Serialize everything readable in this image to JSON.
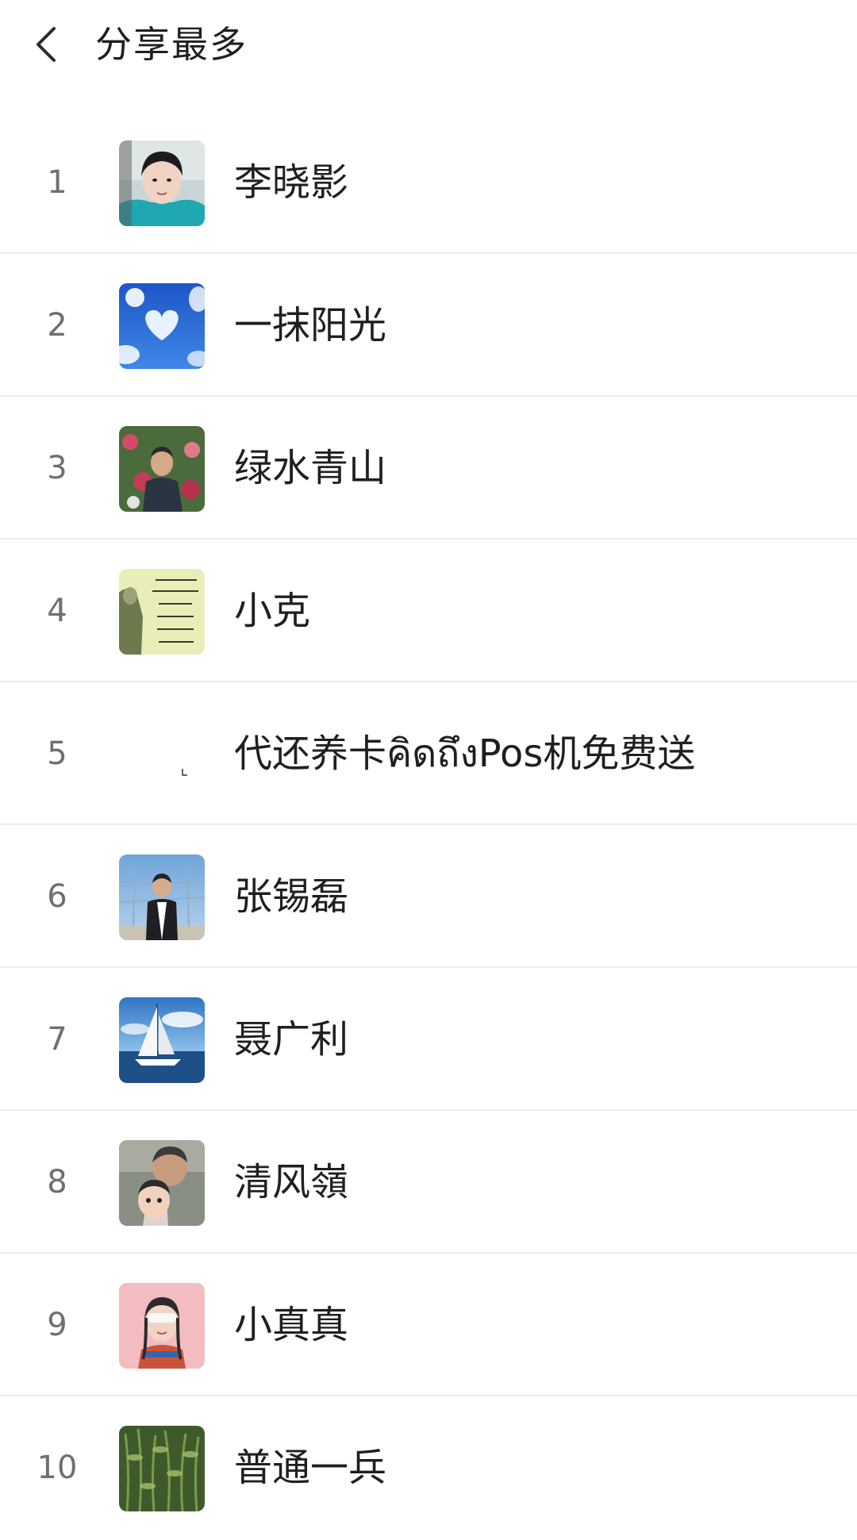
{
  "header": {
    "title": "分享最多",
    "back_icon": "chevron-left-icon"
  },
  "list": {
    "items": [
      {
        "rank": "1",
        "name": "李晓影",
        "avatar": "person-portrait-avatar"
      },
      {
        "rank": "2",
        "name": "一抹阳光",
        "avatar": "heart-cloud-sky-avatar"
      },
      {
        "rank": "3",
        "name": "绿水青山",
        "avatar": "man-flowers-avatar"
      },
      {
        "rank": "4",
        "name": "小克",
        "avatar": "calligraphy-text-avatar"
      },
      {
        "rank": "5",
        "name": "代还养卡คิดถึงPos机免费送",
        "avatar": "blank-avatar"
      },
      {
        "rank": "6",
        "name": "张锡磊",
        "avatar": "man-outdoors-avatar"
      },
      {
        "rank": "7",
        "name": "聂广利",
        "avatar": "sailboat-avatar"
      },
      {
        "rank": "8",
        "name": "清风嶺",
        "avatar": "man-with-child-avatar"
      },
      {
        "rank": "9",
        "name": "小真真",
        "avatar": "girl-eye-mask-avatar"
      },
      {
        "rank": "10",
        "name": "普通一兵",
        "avatar": "plants-avatar"
      }
    ]
  },
  "colors": {
    "background": "#ffffff",
    "divider": "#ececec",
    "rank_text": "#6f6f6f",
    "name_text": "#1f1f1f"
  }
}
